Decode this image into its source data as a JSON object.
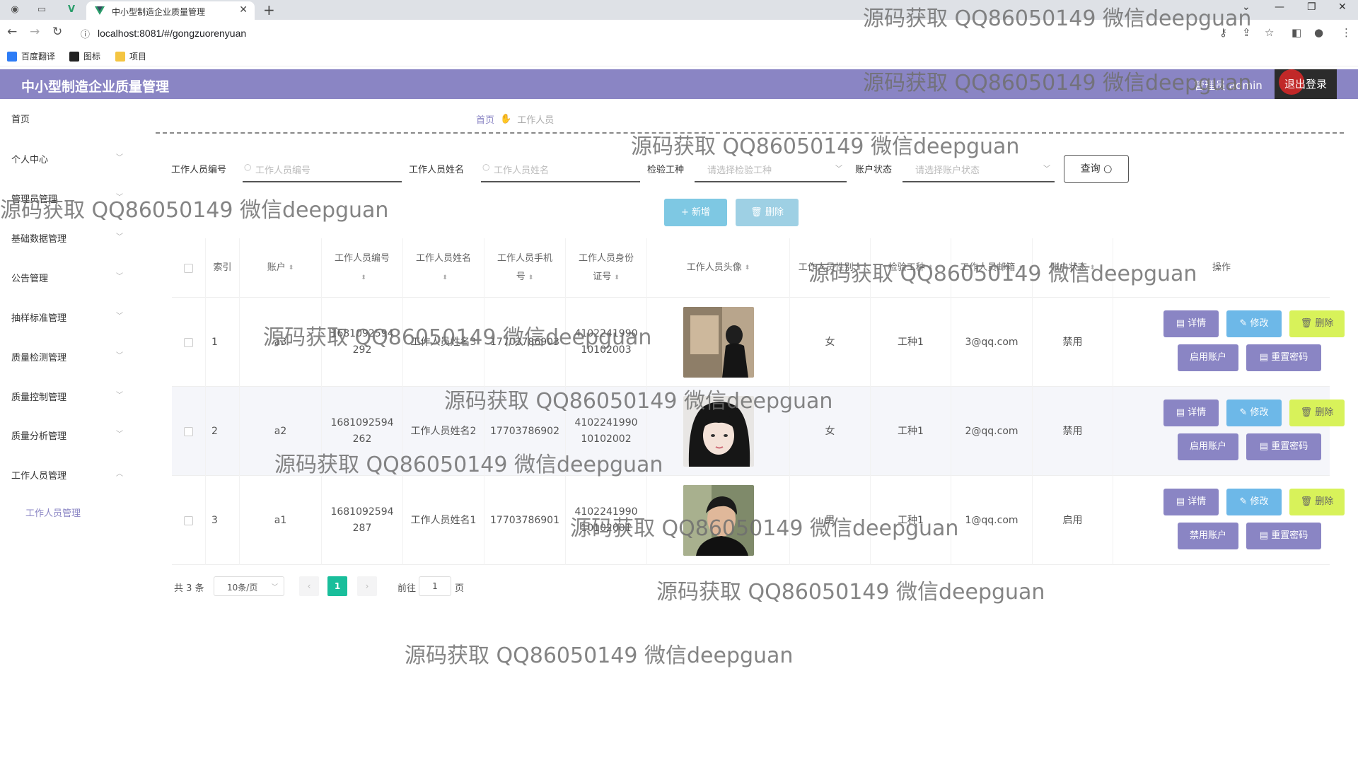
{
  "browser": {
    "tab_title": "中小型制造企业质量管理",
    "url": "localhost:8081/#/gongzuorenyuan",
    "bookmarks": [
      {
        "label": "百度翻译",
        "color": "#2d7cf6"
      },
      {
        "label": "图标",
        "color": "#222222"
      },
      {
        "label": "项目",
        "color": "#f4c542"
      }
    ]
  },
  "header": {
    "title": "中小型制造企业质量管理",
    "user": "管理员 admin",
    "logout": "退出登录",
    "bg_color": "#8a85c4"
  },
  "sidebar": {
    "items": [
      {
        "label": "首页",
        "arrow": ""
      },
      {
        "label": "个人中心",
        "arrow": "﹀"
      },
      {
        "label": "管理员管理",
        "arrow": "﹀"
      },
      {
        "label": "基础数据管理",
        "arrow": "﹀"
      },
      {
        "label": "公告管理",
        "arrow": "﹀"
      },
      {
        "label": "抽样标准管理",
        "arrow": "﹀"
      },
      {
        "label": "质量检测管理",
        "arrow": "﹀"
      },
      {
        "label": "质量控制管理",
        "arrow": "﹀"
      },
      {
        "label": "质量分析管理",
        "arrow": "﹀"
      },
      {
        "label": "工作人员管理",
        "arrow": "︿"
      }
    ],
    "sub_item": "工作人员管理"
  },
  "breadcrumb": {
    "home": "首页",
    "current": "工作人员"
  },
  "search": {
    "fields": [
      {
        "label": "工作人员编号",
        "placeholder": "工作人员编号",
        "type": "input"
      },
      {
        "label": "工作人员姓名",
        "placeholder": "工作人员姓名",
        "type": "input"
      },
      {
        "label": "检验工种",
        "placeholder": "请选择检验工种",
        "type": "select"
      },
      {
        "label": "账户状态",
        "placeholder": "请选择账户状态",
        "type": "select"
      }
    ],
    "query_button": "查询"
  },
  "actions": {
    "add": "新增",
    "delete": "删除",
    "add_color": "#7ec8e3",
    "delete_color": "#9ed0e4"
  },
  "table": {
    "columns": [
      {
        "label": "索引",
        "sortable": false
      },
      {
        "label": "账户",
        "sortable": true
      },
      {
        "label": "工作人员编号",
        "sortable": true
      },
      {
        "label": "工作人员姓名",
        "sortable": true
      },
      {
        "label": "工作人员手机号",
        "sortable": true
      },
      {
        "label": "工作人员身份证号",
        "sortable": true
      },
      {
        "label": "工作人员头像",
        "sortable": true
      },
      {
        "label": "工作人员性别",
        "sortable": true
      },
      {
        "label": "检验工种",
        "sortable": true
      },
      {
        "label": "工作人员邮箱",
        "sortable": true
      },
      {
        "label": "账户状态",
        "sortable": true
      },
      {
        "label": "操作",
        "sortable": false
      }
    ],
    "rows": [
      {
        "index": "1",
        "account": "a3",
        "number": "1681092594292",
        "name": "工作人员姓名3",
        "phone": "17703786903",
        "idcard": "410224199010102003",
        "gender": "女",
        "worktype": "工种1",
        "email": "3@qq.com",
        "status": "禁用",
        "toggle_label": "启用账户",
        "avatar": "avatar-man-back"
      },
      {
        "index": "2",
        "account": "a2",
        "number": "1681092594262",
        "name": "工作人员姓名2",
        "phone": "17703786902",
        "idcard": "410224199010102002",
        "gender": "女",
        "worktype": "工种1",
        "email": "2@qq.com",
        "status": "禁用",
        "toggle_label": "启用账户",
        "avatar": "avatar-girl"
      },
      {
        "index": "3",
        "account": "a1",
        "number": "1681092594287",
        "name": "工作人员姓名1",
        "phone": "17703786901",
        "idcard": "410224199010102001",
        "gender": "男",
        "worktype": "工种1",
        "email": "1@qq.com",
        "status": "启用",
        "toggle_label": "禁用账户",
        "avatar": "avatar-man"
      }
    ],
    "row_buttons": {
      "detail": "详情",
      "edit": "修改",
      "delete": "删除",
      "reset": "重置密码"
    },
    "colors": {
      "purple": "#8a85c4",
      "blue": "#6db8e8",
      "yellow": "#d8f25a"
    }
  },
  "pagination": {
    "total": "共 3 条",
    "page_size": "10条/页",
    "current": "1",
    "goto_prefix": "前往",
    "goto_value": "1",
    "goto_suffix": "页",
    "active_color": "#19be9b"
  },
  "watermark": "源码获取 QQ86050149 微信deepguan"
}
